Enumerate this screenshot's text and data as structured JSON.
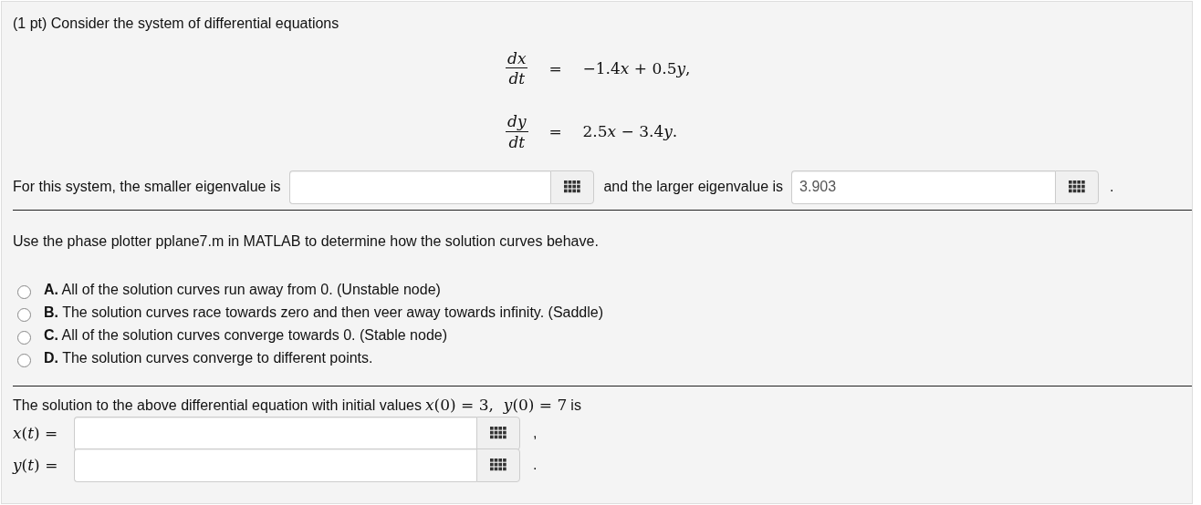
{
  "intro": "(1 pt) Consider the system of differential equations",
  "equations": [
    {
      "numerator": "dx",
      "denominator": "dt",
      "equals": "=",
      "rhs": "−1.4x + 0.5y,"
    },
    {
      "numerator": "dy",
      "denominator": "dt",
      "equals": "=",
      "rhs": "2.5x − 3.4y."
    }
  ],
  "eigen": {
    "text_before": "For this system, the smaller eigenvalue is",
    "text_middle": "and the larger eigenvalue is",
    "larger_value": "3.903",
    "text_end": "."
  },
  "instructions": "Use the phase plotter pplane7.m in MATLAB to determine how the solution curves behave.",
  "options": [
    {
      "letter": "A.",
      "text": "All of the solution curves run away from 0. (Unstable node)",
      "selected": false
    },
    {
      "letter": "B.",
      "text": "The solution curves race towards zero and then veer away towards infinity. (Saddle)",
      "selected": false
    },
    {
      "letter": "C.",
      "text": "All of the solution curves converge towards 0. (Stable node)",
      "selected": false
    },
    {
      "letter": "D.",
      "text": "The solution curves converge to different points.",
      "selected": false
    }
  ],
  "solution": {
    "text_before": "The solution to the above differential equation with initial values",
    "conditions": "x(0) = 3,  y(0) = 7",
    "text_after": "is",
    "answers": [
      {
        "label": "x(t) =",
        "end": ","
      },
      {
        "label": "y(t) =",
        "end": "."
      }
    ]
  }
}
